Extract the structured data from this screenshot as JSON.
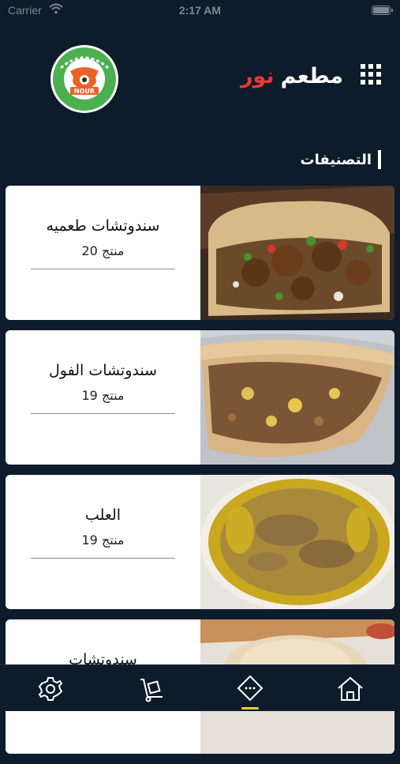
{
  "status_bar": {
    "carrier": "Carrier",
    "time": "2:17 AM"
  },
  "header": {
    "title_part1": "مطعم",
    "title_part2": "نور",
    "title_part2_color": "#e53935",
    "logo_text": "NOUR"
  },
  "section": {
    "heading": "التصنيفات"
  },
  "categories": [
    {
      "name": "سندوتشات طعميه",
      "count": "20 منتج",
      "image": "falafel sandwich"
    },
    {
      "name": "سندوتشات الفول",
      "count": "19 منتج",
      "image": "foul sandwich"
    },
    {
      "name": "العلب",
      "count": "19 منتج",
      "image": "foul bowl"
    },
    {
      "name": "سندوتشات",
      "count": "",
      "image": "pita bread"
    }
  ],
  "bottom_nav": [
    {
      "icon": "gear-icon"
    },
    {
      "icon": "delivery-cart-icon"
    },
    {
      "icon": "menu-tag-icon",
      "active": true
    },
    {
      "icon": "home-icon"
    }
  ],
  "colors": {
    "background": "#0d1b2a",
    "accent": "#f2c84b",
    "brand_red": "#e53935",
    "logo_green": "#4caf50"
  }
}
